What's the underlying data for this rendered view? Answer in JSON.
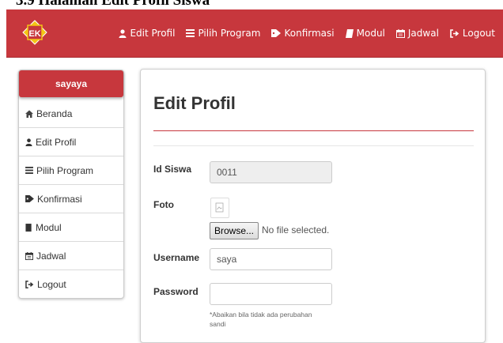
{
  "caption": "3.9 Halaman Edit Profil Siswa",
  "colors": {
    "brand": "#c7373d",
    "text": "#333333"
  },
  "navbar": {
    "logo_icon": "ek-logo-icon",
    "items": [
      {
        "label": "Edit Profil",
        "icon": "user-icon"
      },
      {
        "label": "Pilih Program",
        "icon": "list-icon"
      },
      {
        "label": "Konfirmasi",
        "icon": "tag-icon"
      },
      {
        "label": "Modul",
        "icon": "book-icon"
      },
      {
        "label": "Jadwal",
        "icon": "calendar-icon"
      },
      {
        "label": "Logout",
        "icon": "logout-icon"
      }
    ]
  },
  "sidebar": {
    "username": "sayaya",
    "items": [
      {
        "label": "Beranda",
        "icon": "home-icon"
      },
      {
        "label": "Edit Profil",
        "icon": "user-icon"
      },
      {
        "label": "Pilih Program",
        "icon": "list-icon"
      },
      {
        "label": "Konfirmasi",
        "icon": "tag-icon"
      },
      {
        "label": "Modul",
        "icon": "book-icon"
      },
      {
        "label": "Jadwal",
        "icon": "calendar-icon"
      },
      {
        "label": "Logout",
        "icon": "logout-icon"
      }
    ]
  },
  "main": {
    "title": "Edit Profil",
    "form": {
      "id_label": "Id Siswa",
      "id_value": "0011",
      "foto_label": "Foto",
      "browse_label": "Browse...",
      "file_status": "No file selected.",
      "username_label": "Username",
      "username_value": "saya",
      "password_label": "Password",
      "password_value": "",
      "password_help": "*Abaikan bila tidak ada perubahan sandi"
    }
  }
}
